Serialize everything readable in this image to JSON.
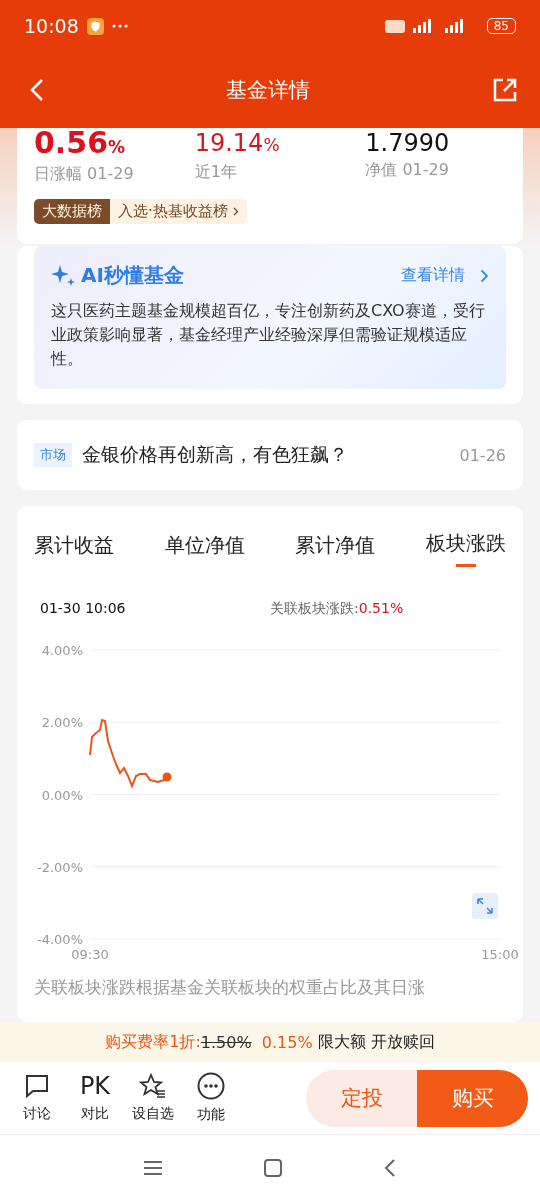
{
  "status_bar": {
    "time": "10:08",
    "battery": "85"
  },
  "header": {
    "title": "基金详情"
  },
  "summary": {
    "stats": [
      {
        "value": "0.56",
        "unit": "%",
        "label": "日涨幅 01-29",
        "kind": "up"
      },
      {
        "value": "19.14",
        "unit": "%",
        "label": "近1年",
        "kind": "up"
      },
      {
        "value": "1.7990",
        "label": "净值 01-29",
        "kind": "plain"
      }
    ],
    "badge": {
      "tag": "大数据榜",
      "text": "入选·热基收益榜"
    }
  },
  "ai_card": {
    "title": "AI秒懂基金",
    "link": "查看详情",
    "text": "这只医药主题基金规模超百亿，专注创新药及CXO赛道，受行业政策影响显著，基金经理产业经验深厚但需验证规模适应性。"
  },
  "news": {
    "tag": "市场",
    "title": "金银价格再创新高，有色狂飙？",
    "date": "01-26"
  },
  "chart_tabs": [
    {
      "label": "累计收益",
      "selected": false
    },
    {
      "label": "单位净值",
      "selected": false
    },
    {
      "label": "累计净值",
      "selected": false
    },
    {
      "label": "板块涨跌",
      "selected": true
    }
  ],
  "chart_panel": {
    "timestamp": "01-30 10:06",
    "reading_label": "关联板块涨跌:",
    "reading": "0.51%",
    "y_axis_labels": [
      "4.00%",
      "2.00%",
      "0.00%",
      "-2.00%",
      "-4.00%"
    ],
    "x_axis_labels": [
      "09:30",
      "15:00"
    ],
    "note": "关联板块涨跌根据基金关联板块的权重占比及其日涨"
  },
  "fee_bar": {
    "label": "购买费率1折:",
    "old_rate": "1.50%",
    "new_rate": "0.15%",
    "notes": "限大额 开放赎回"
  },
  "bottom_actions": [
    {
      "label": "讨论",
      "kind": "chat"
    },
    {
      "label": "对比",
      "kind": "pk",
      "glyph": "PK"
    },
    {
      "label": "设自选",
      "kind": "star"
    },
    {
      "label": "功能",
      "kind": "more"
    }
  ],
  "buttons": [
    {
      "label": "定投",
      "kind": "secondary"
    },
    {
      "label": "购买",
      "kind": "primary"
    }
  ]
}
